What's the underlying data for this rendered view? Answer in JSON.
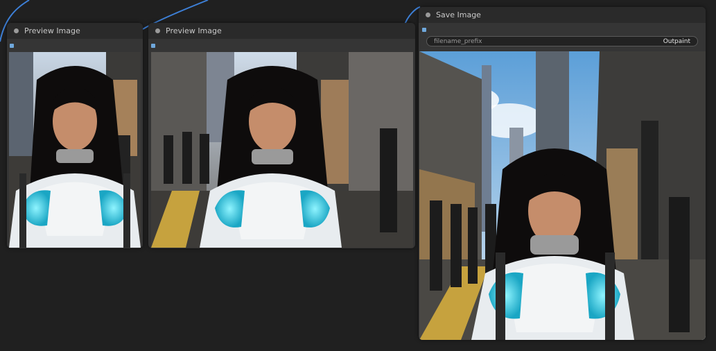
{
  "nodes": {
    "preview1": {
      "title": "Preview Image"
    },
    "preview2": {
      "title": "Preview Image"
    },
    "save": {
      "title": "Save Image",
      "widget": {
        "label": "filename_prefix",
        "value": "Outpaint"
      }
    }
  },
  "colors": {
    "canvas": "#202020",
    "node_body": "#353535",
    "node_header": "#2a2a2a",
    "link": "#3d7fd6",
    "slot": "#6fa8dc"
  },
  "images": {
    "preview1": "portrait of a young woman in a white-and-cyan space suit on a city street",
    "preview2": "wider outpainted view of the woman on the city street with pedestrians",
    "save": "full outpainted city street scene with skyscrapers, pedestrians and the woman"
  }
}
